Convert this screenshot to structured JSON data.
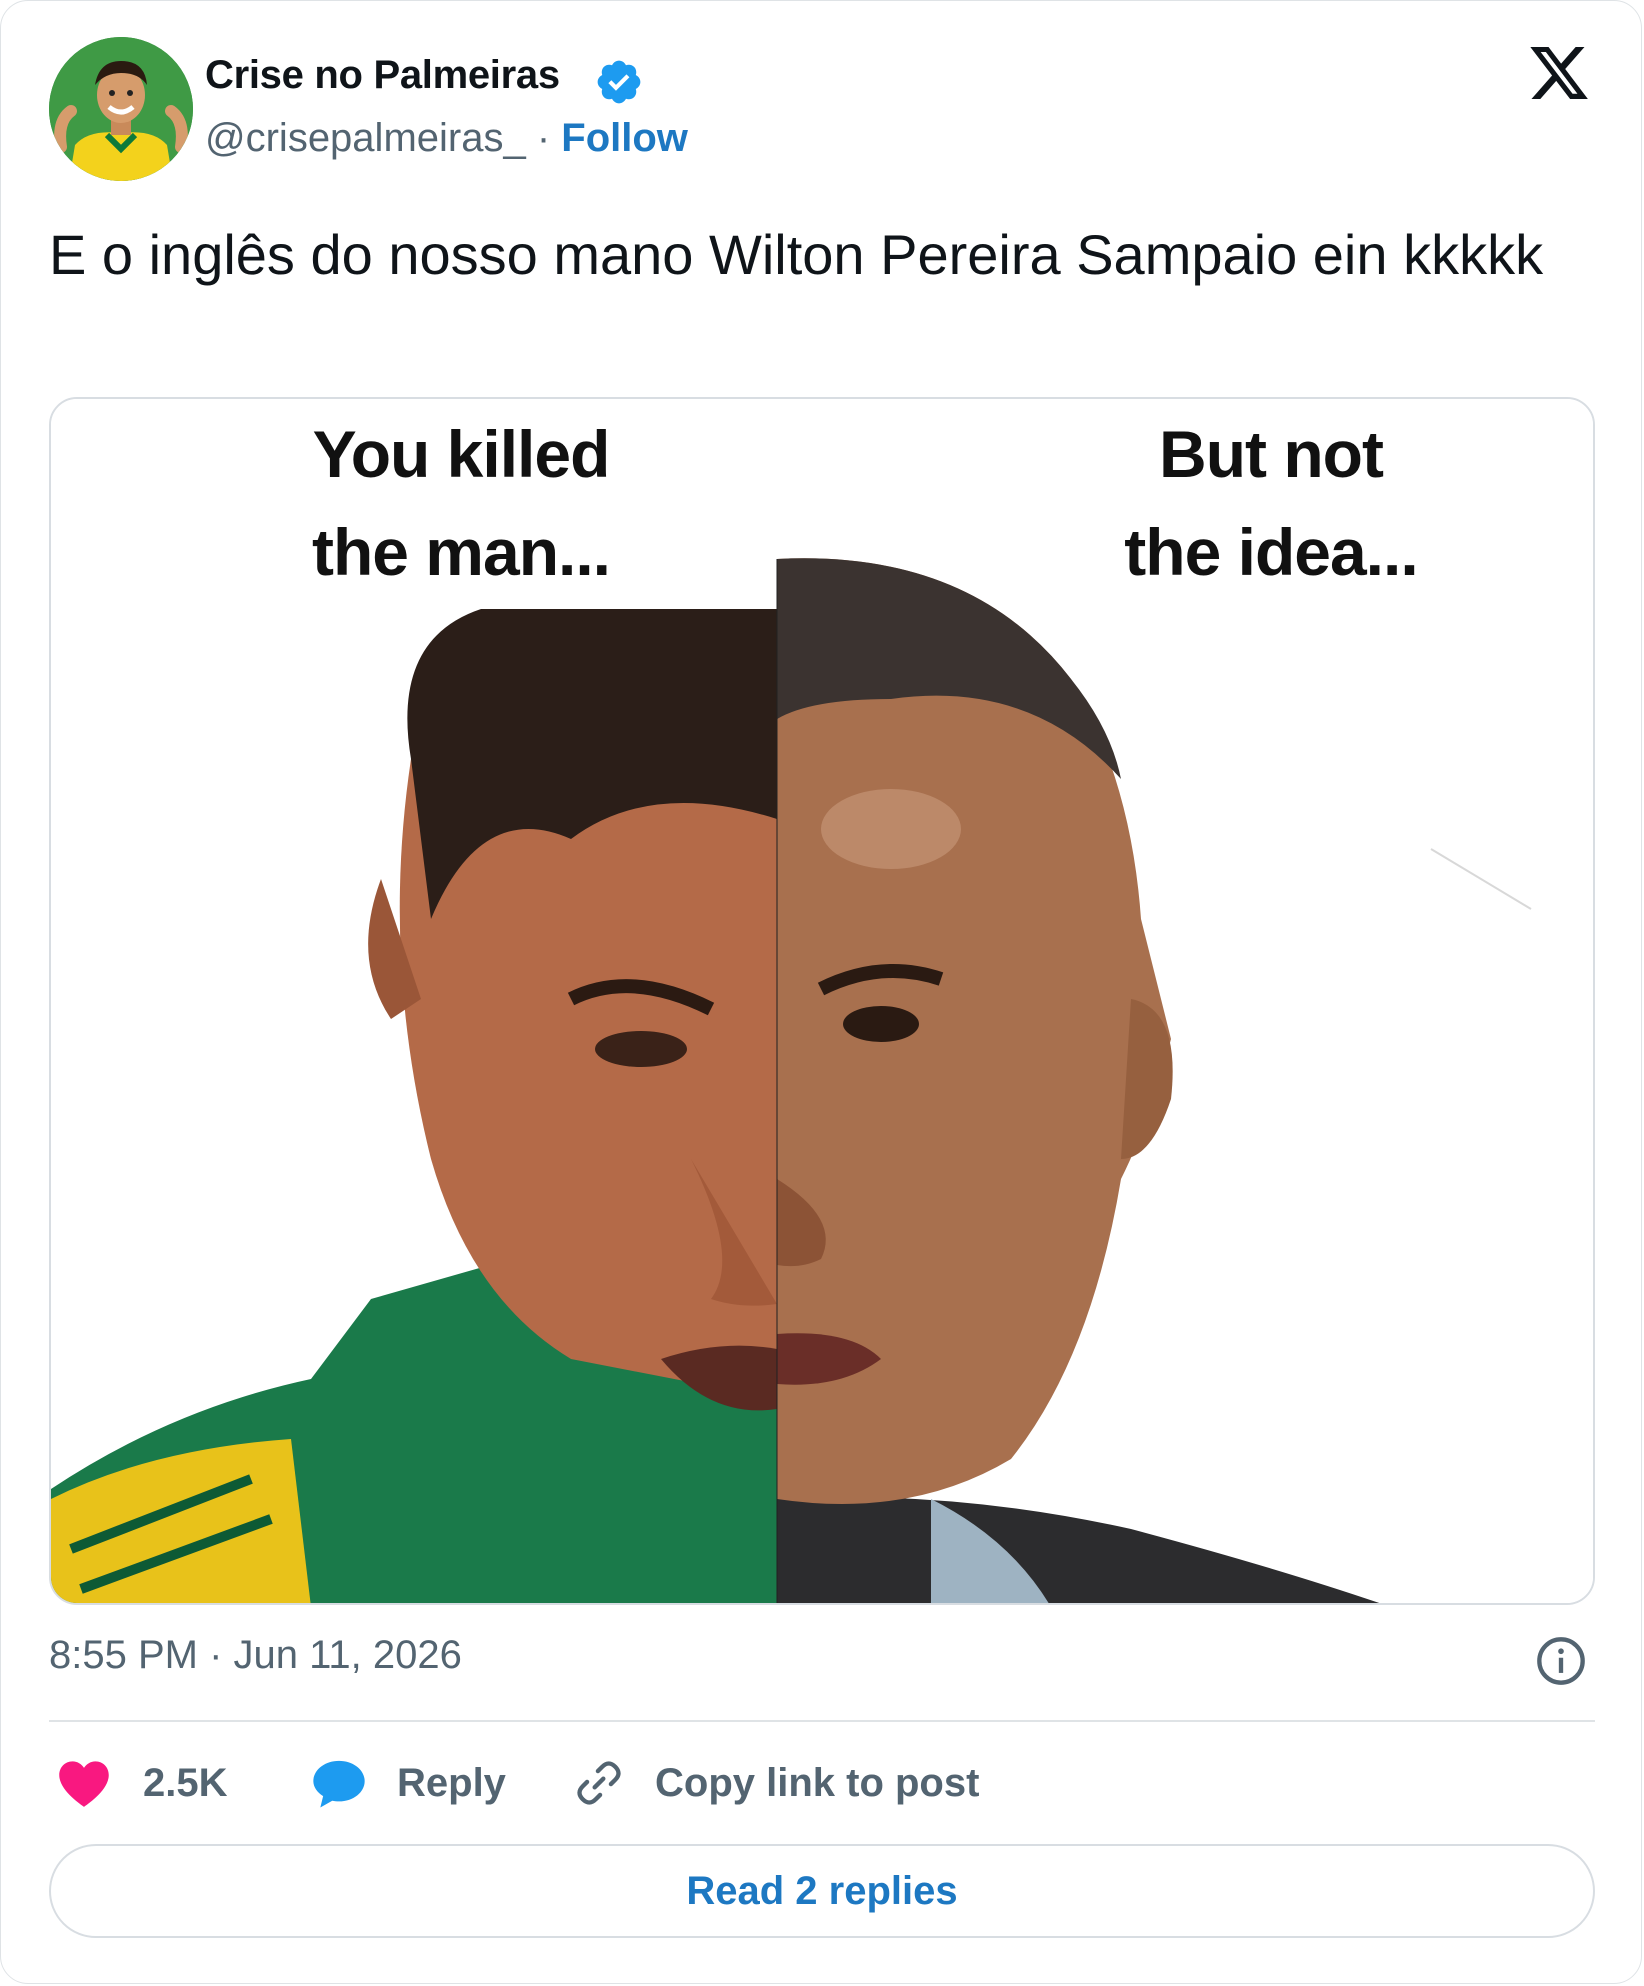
{
  "author": {
    "name": "Crise no Palmeiras",
    "handle": "@crisepalmeiras_",
    "separator": "·",
    "follow_label": "Follow"
  },
  "icons": {
    "verified": "verified-badge-icon",
    "platform": "x-logo-icon",
    "info": "info-icon",
    "like": "heart-icon",
    "reply": "speech-bubble-icon",
    "copy_link": "link-icon"
  },
  "tweet": {
    "text": "E o inglês do nosso mano Wilton Pereira Sampaio ein kkkkk",
    "timestamp": "8:55 PM · Jun 11, 2026"
  },
  "media": {
    "left_caption_line1": "You killed",
    "left_caption_line2": "the man...",
    "right_caption_line1": "But not",
    "right_caption_line2": "the idea..."
  },
  "actions": {
    "likes_count": "2.5K",
    "reply_label": "Reply",
    "copy_link_label": "Copy link to post"
  },
  "read_replies_label": "Read 2 replies",
  "colors": {
    "accent": "#1d78c2",
    "verified": "#1d9bf0",
    "like": "#f91880",
    "muted_text": "#536471",
    "border": "#dfe3e6"
  }
}
